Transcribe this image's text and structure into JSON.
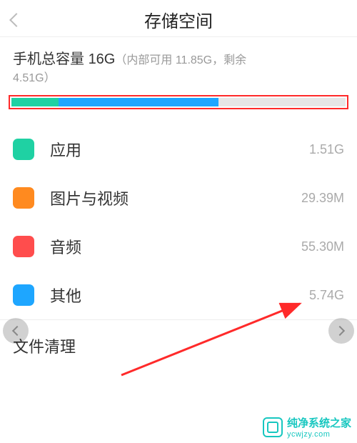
{
  "header": {
    "title": "存储空间"
  },
  "summary": {
    "prefix": "手机总容量 ",
    "total": "16G",
    "detail_open": "（内部可用 ",
    "internal_available": "11.85G",
    "detail_mid": "，剩余",
    "remaining": "4.51G",
    "detail_close": "）"
  },
  "bar": {
    "segments": [
      {
        "color": "#1fd1a3",
        "start": 0,
        "width": 14
      },
      {
        "color": "#1ea6ff",
        "start": 14,
        "width": 48
      }
    ]
  },
  "categories": [
    {
      "color": "#1fd1a3",
      "label": "应用",
      "value": "1.51G"
    },
    {
      "color": "#ff8a1f",
      "label": "图片与视频",
      "value": "29.39M"
    },
    {
      "color": "#ff4d4d",
      "label": "音频",
      "value": "55.30M"
    },
    {
      "color": "#1ea6ff",
      "label": "其他",
      "value": "5.74G"
    }
  ],
  "cleanup": {
    "label": "文件清理"
  },
  "watermark": {
    "line1": "纯净系统之家",
    "line2": "ycwjzy.com"
  }
}
